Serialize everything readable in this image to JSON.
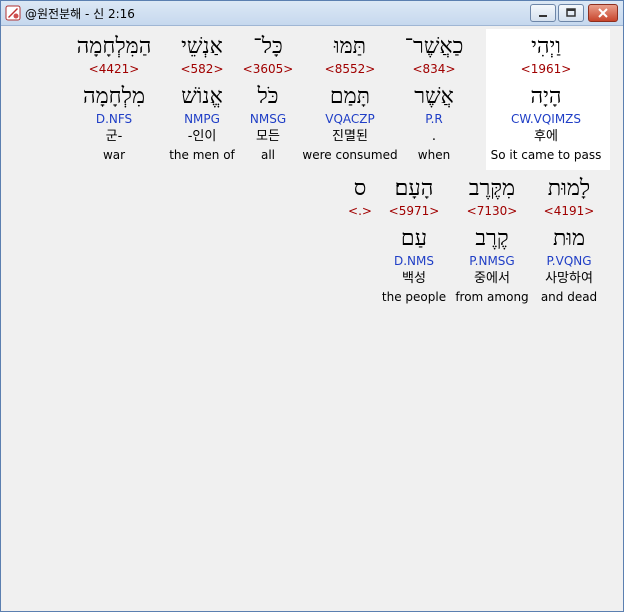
{
  "window": {
    "title": "@원전분해 - 신 2:16"
  },
  "rows": [
    [
      {
        "heb": "וַיְהִי",
        "strong": "<1961>",
        "lemma": "הָיָה",
        "parse": "CW.VQIMZS",
        "kor": "후에",
        "eng": "So it came to pass"
      },
      {
        "heb": "כַאֲשֶׁר־",
        "strong": "<834>",
        "lemma": "אֲשֶׁר",
        "parse": "P.R",
        "kor": ".",
        "eng": "when"
      },
      {
        "heb": "תַּמּוּ",
        "strong": "<8552>",
        "lemma": "תָּמַם",
        "parse": "VQACZP",
        "kor": "진멸된",
        "eng": "were consumed"
      },
      {
        "heb": "כָּל־",
        "strong": "<3605>",
        "lemma": "כֹּל",
        "parse": "NMSG",
        "kor": "모든",
        "eng": "all"
      },
      {
        "heb": "אַנְשֵׁי",
        "strong": "<582>",
        "lemma": "אֱנוֹשׁ",
        "parse": "NMPG",
        "kor": "-인이",
        "eng": "the men of"
      },
      {
        "heb": "הַמִּלְחָמָה",
        "strong": "<4421>",
        "lemma": "מִלְחָמָה",
        "parse": "D.NFS",
        "kor": "군-",
        "eng": "war"
      }
    ],
    [
      {
        "heb": "לָמוּת",
        "strong": "<4191>",
        "lemma": "מוּת",
        "parse": "P.VQNG",
        "kor": "사망하여",
        "eng": "and dead"
      },
      {
        "heb": "מִקֶּרֶב",
        "strong": "<7130>",
        "lemma": "קֶרֶב",
        "parse": "P.NMSG",
        "kor": "중에서",
        "eng": "from among"
      },
      {
        "heb": "הָעָם׃",
        "strong": "<5971>",
        "lemma": "עַם",
        "parse": "D.NMS",
        "kor": "백성",
        "eng": "the people"
      },
      {
        "heb": "ס",
        "strong": "<.>",
        "lemma": "",
        "parse": "",
        "kor": "",
        "eng": ""
      }
    ]
  ]
}
